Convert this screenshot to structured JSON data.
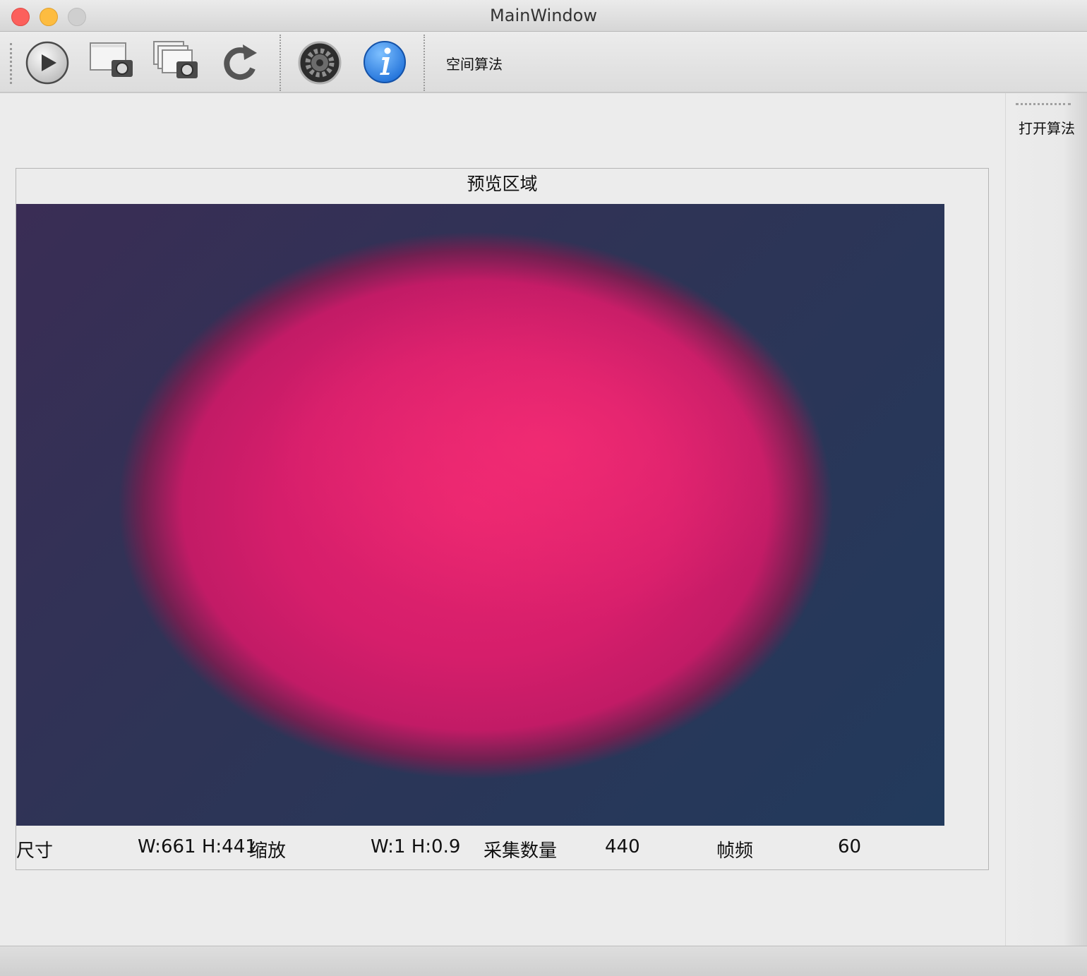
{
  "window": {
    "title": "MainWindow"
  },
  "toolbar": {
    "buttons": [
      {
        "name": "play",
        "icon": "play-icon"
      },
      {
        "name": "capture",
        "icon": "capture-icon"
      },
      {
        "name": "capture-multi",
        "icon": "multi-capture-icon"
      },
      {
        "name": "refresh",
        "icon": "refresh-icon"
      },
      {
        "name": "settings",
        "icon": "gear-icon"
      },
      {
        "name": "info",
        "icon": "info-icon"
      }
    ],
    "spatial_algorithm_label": "空间算法"
  },
  "dock": {
    "open_algorithm_label": "打开算法"
  },
  "preview": {
    "title": "预览区域",
    "size_label": "尺寸",
    "size_value": "W:661 H:441",
    "zoom_label": "缩放",
    "zoom_value": "W:1 H:0.9",
    "capture_count_label": "采集数量",
    "capture_count_value": "440",
    "frame_rate_label": "帧频",
    "frame_rate_value": "60"
  },
  "colors": {
    "accent_blue": "#1e6fd8",
    "preview_spot": "#e5246e",
    "preview_background": "#2e3456"
  }
}
